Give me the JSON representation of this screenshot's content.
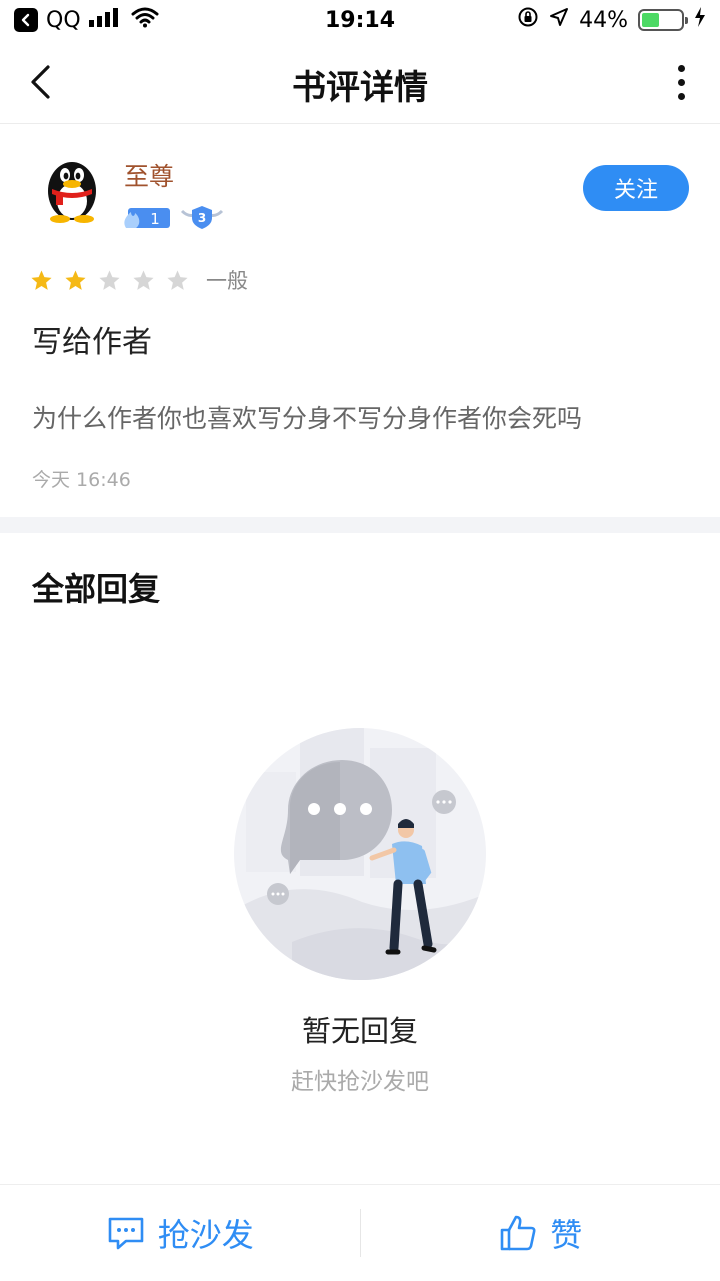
{
  "status_bar": {
    "carrier": "QQ",
    "time": "19:14",
    "battery_percent": "44%",
    "battery_level": 0.44
  },
  "nav": {
    "title": "书评详情"
  },
  "review": {
    "username": "至尊",
    "fire_badge_count": "1",
    "level_badge": "3",
    "follow_label": "关注",
    "rating": 2,
    "rating_max": 5,
    "rating_label": "一般",
    "title": "写给作者",
    "body": "为什么作者你也喜欢写分身不写分身作者你会死吗",
    "time": "今天 16:46"
  },
  "replies": {
    "section_title": "全部回复",
    "empty_title": "暂无回复",
    "empty_subtitle": "赶快抢沙发吧"
  },
  "bottom_bar": {
    "comment_label": "抢沙发",
    "like_label": "赞"
  },
  "colors": {
    "accent": "#2f8df4",
    "star_filled": "#f5b916",
    "star_empty": "#d6d6d6",
    "username": "#a0522d"
  }
}
